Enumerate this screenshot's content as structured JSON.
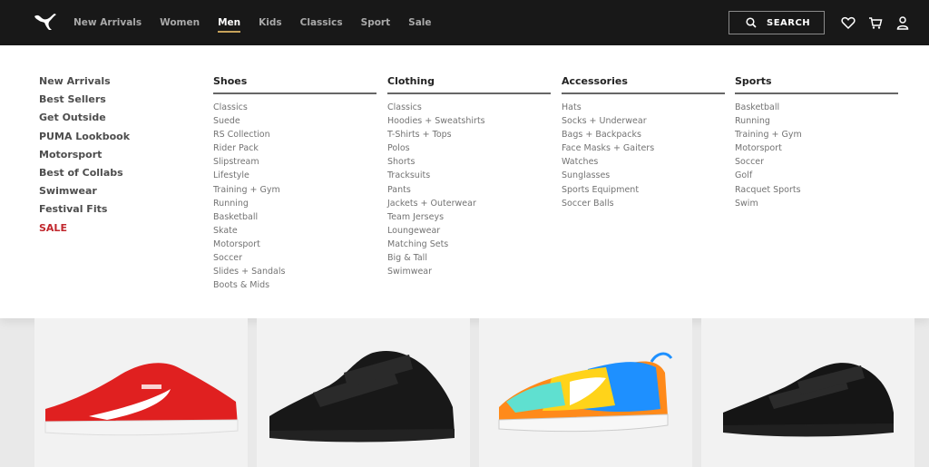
{
  "header": {
    "nav": [
      "New Arrivals",
      "Women",
      "Men",
      "Kids",
      "Classics",
      "Sport",
      "Sale"
    ],
    "active_nav": "Men",
    "search_label": "SEARCH"
  },
  "menu": {
    "quick_links": [
      "New Arrivals",
      "Best Sellers",
      "Get Outside",
      "PUMA Lookbook",
      "Motorsport",
      "Best of Collabs",
      "Swimwear",
      "Festival Fits",
      "SALE"
    ],
    "columns": [
      {
        "title": "Shoes",
        "items": [
          "Classics",
          "Suede",
          "RS Collection",
          "Rider Pack",
          "Slipstream",
          "Lifestyle",
          "Training + Gym",
          "Running",
          "Basketball",
          "Skate",
          "Motorsport",
          "Soccer",
          "Slides + Sandals",
          "Boots & Mids"
        ]
      },
      {
        "title": "Clothing",
        "items": [
          "Classics",
          "Hoodies + Sweatshirts",
          "T-Shirts + Tops",
          "Polos",
          "Shorts",
          "Tracksuits",
          "Pants",
          "Jackets + Outerwear",
          "Team Jerseys",
          "Loungewear",
          "Matching Sets",
          "Big & Tall",
          "Swimwear"
        ]
      },
      {
        "title": "Accessories",
        "items": [
          "Hats",
          "Socks + Underwear",
          "Bags + Backpacks",
          "Face Masks + Gaiters",
          "Watches",
          "Sunglasses",
          "Sports Equipment",
          "Soccer Balls"
        ]
      },
      {
        "title": "Sports",
        "items": [
          "Basketball",
          "Running",
          "Training + Gym",
          "Motorsport",
          "Soccer",
          "Golf",
          "Racquet Sports",
          "Swim"
        ]
      }
    ]
  },
  "colors": {
    "topbar": "#181818",
    "sale": "#c1272d",
    "active_underline": "#c6a25a"
  },
  "products": [
    {
      "color": "red",
      "icon": "red-sneaker-image"
    },
    {
      "color": "black",
      "icon": "black-velcro-sneaker-image"
    },
    {
      "color": "multicolor",
      "icon": "multicolor-runner-sneaker-image"
    },
    {
      "color": "black",
      "icon": "black-velcro-sneaker-image"
    }
  ]
}
